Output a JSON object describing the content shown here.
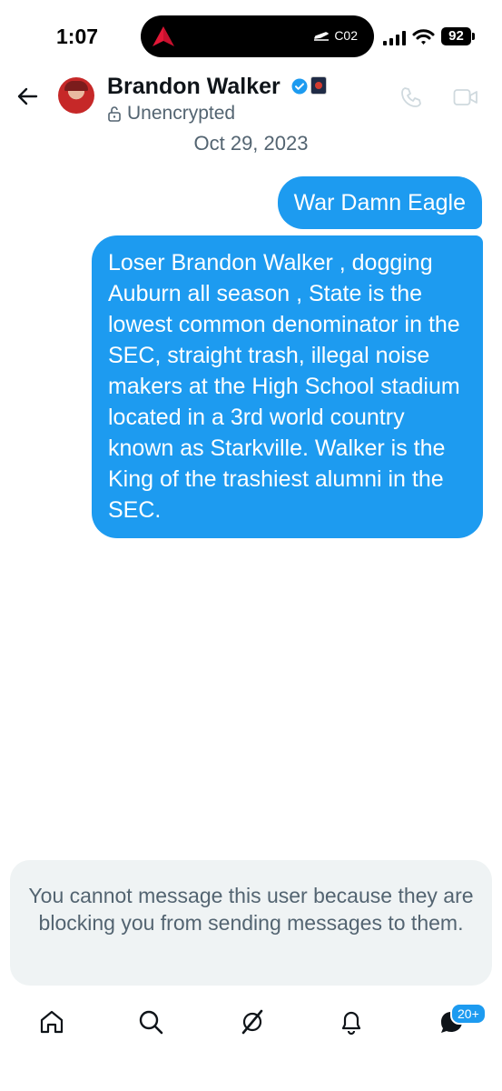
{
  "status_bar": {
    "time": "1:07",
    "flight_code": "C02",
    "battery": "92"
  },
  "header": {
    "name": "Brandon Walker",
    "encryption": "Unencrypted"
  },
  "conversation": {
    "date": "Oct 29, 2023",
    "messages": [
      {
        "text": "War Damn Eagle"
      },
      {
        "text": "Loser Brandon Walker , dogging Auburn all season , State is the lowest common denominator in the SEC, straight trash, illegal noise makers at the High School stadium located in a 3rd world country known as Starkville. Walker is the King of the trashiest alumni in the SEC."
      }
    ]
  },
  "notice": {
    "text": "You cannot message this user because they are blocking you from sending messages to them."
  },
  "nav": {
    "messages_badge": "20+"
  },
  "colors": {
    "accent": "#1d9bf0",
    "text_secondary": "#536471",
    "notice_bg": "#eff3f4"
  },
  "icons": [
    "delta-logo-icon",
    "airplane-icon",
    "signal-icon",
    "wifi-icon",
    "back-arrow-icon",
    "verified-icon",
    "lock-icon",
    "phone-icon",
    "video-icon",
    "home-icon",
    "search-icon",
    "grok-icon",
    "bell-icon",
    "messages-icon"
  ]
}
